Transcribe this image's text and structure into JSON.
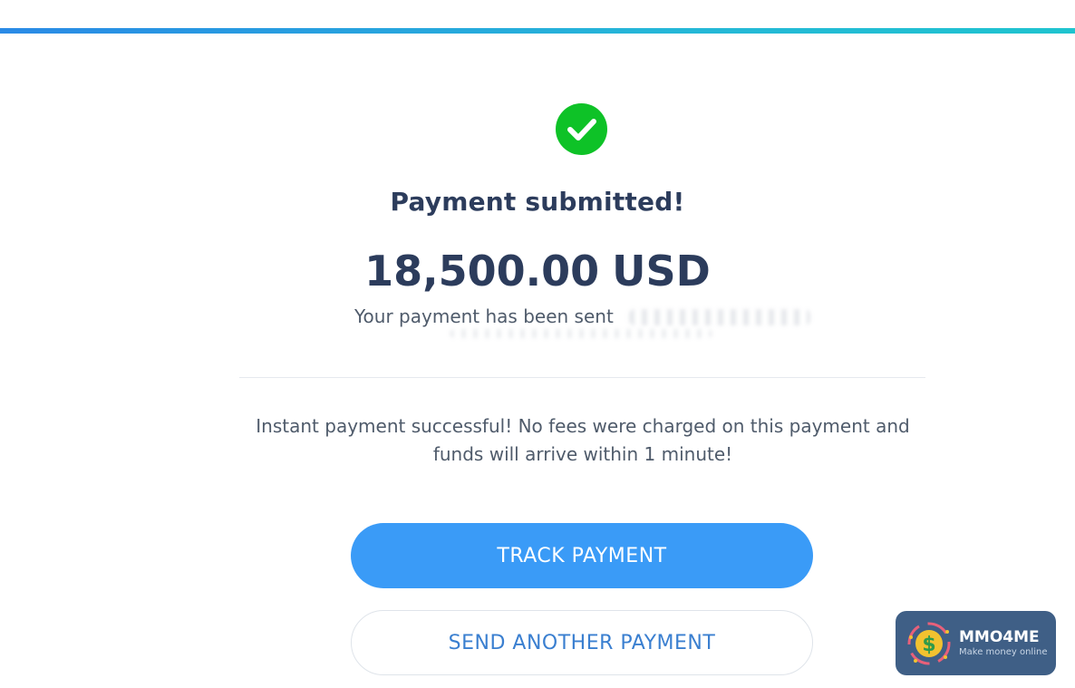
{
  "status": {
    "icon": "check-circle-icon",
    "title": "Payment submitted!",
    "amount_value": "18,500.00",
    "amount_currency": "USD",
    "sent_text": "Your payment has been sent"
  },
  "info": {
    "line1": "Instant payment successful! No fees were charged on this payment and",
    "line2": "funds will arrive within 1 minute!"
  },
  "actions": {
    "track_label": "TRACK PAYMENT",
    "send_another_label": "SEND ANOTHER PAYMENT"
  },
  "watermark": {
    "name": "MMO4ME",
    "tagline": "Make money online",
    "icon": "dollar-logo-icon"
  },
  "colors": {
    "success": "#0ec227",
    "primary_button": "#3a9bf7",
    "heading": "#2c3c5c",
    "accent_bar_start": "#2a8ae6",
    "accent_bar_end": "#1fc4cf"
  }
}
